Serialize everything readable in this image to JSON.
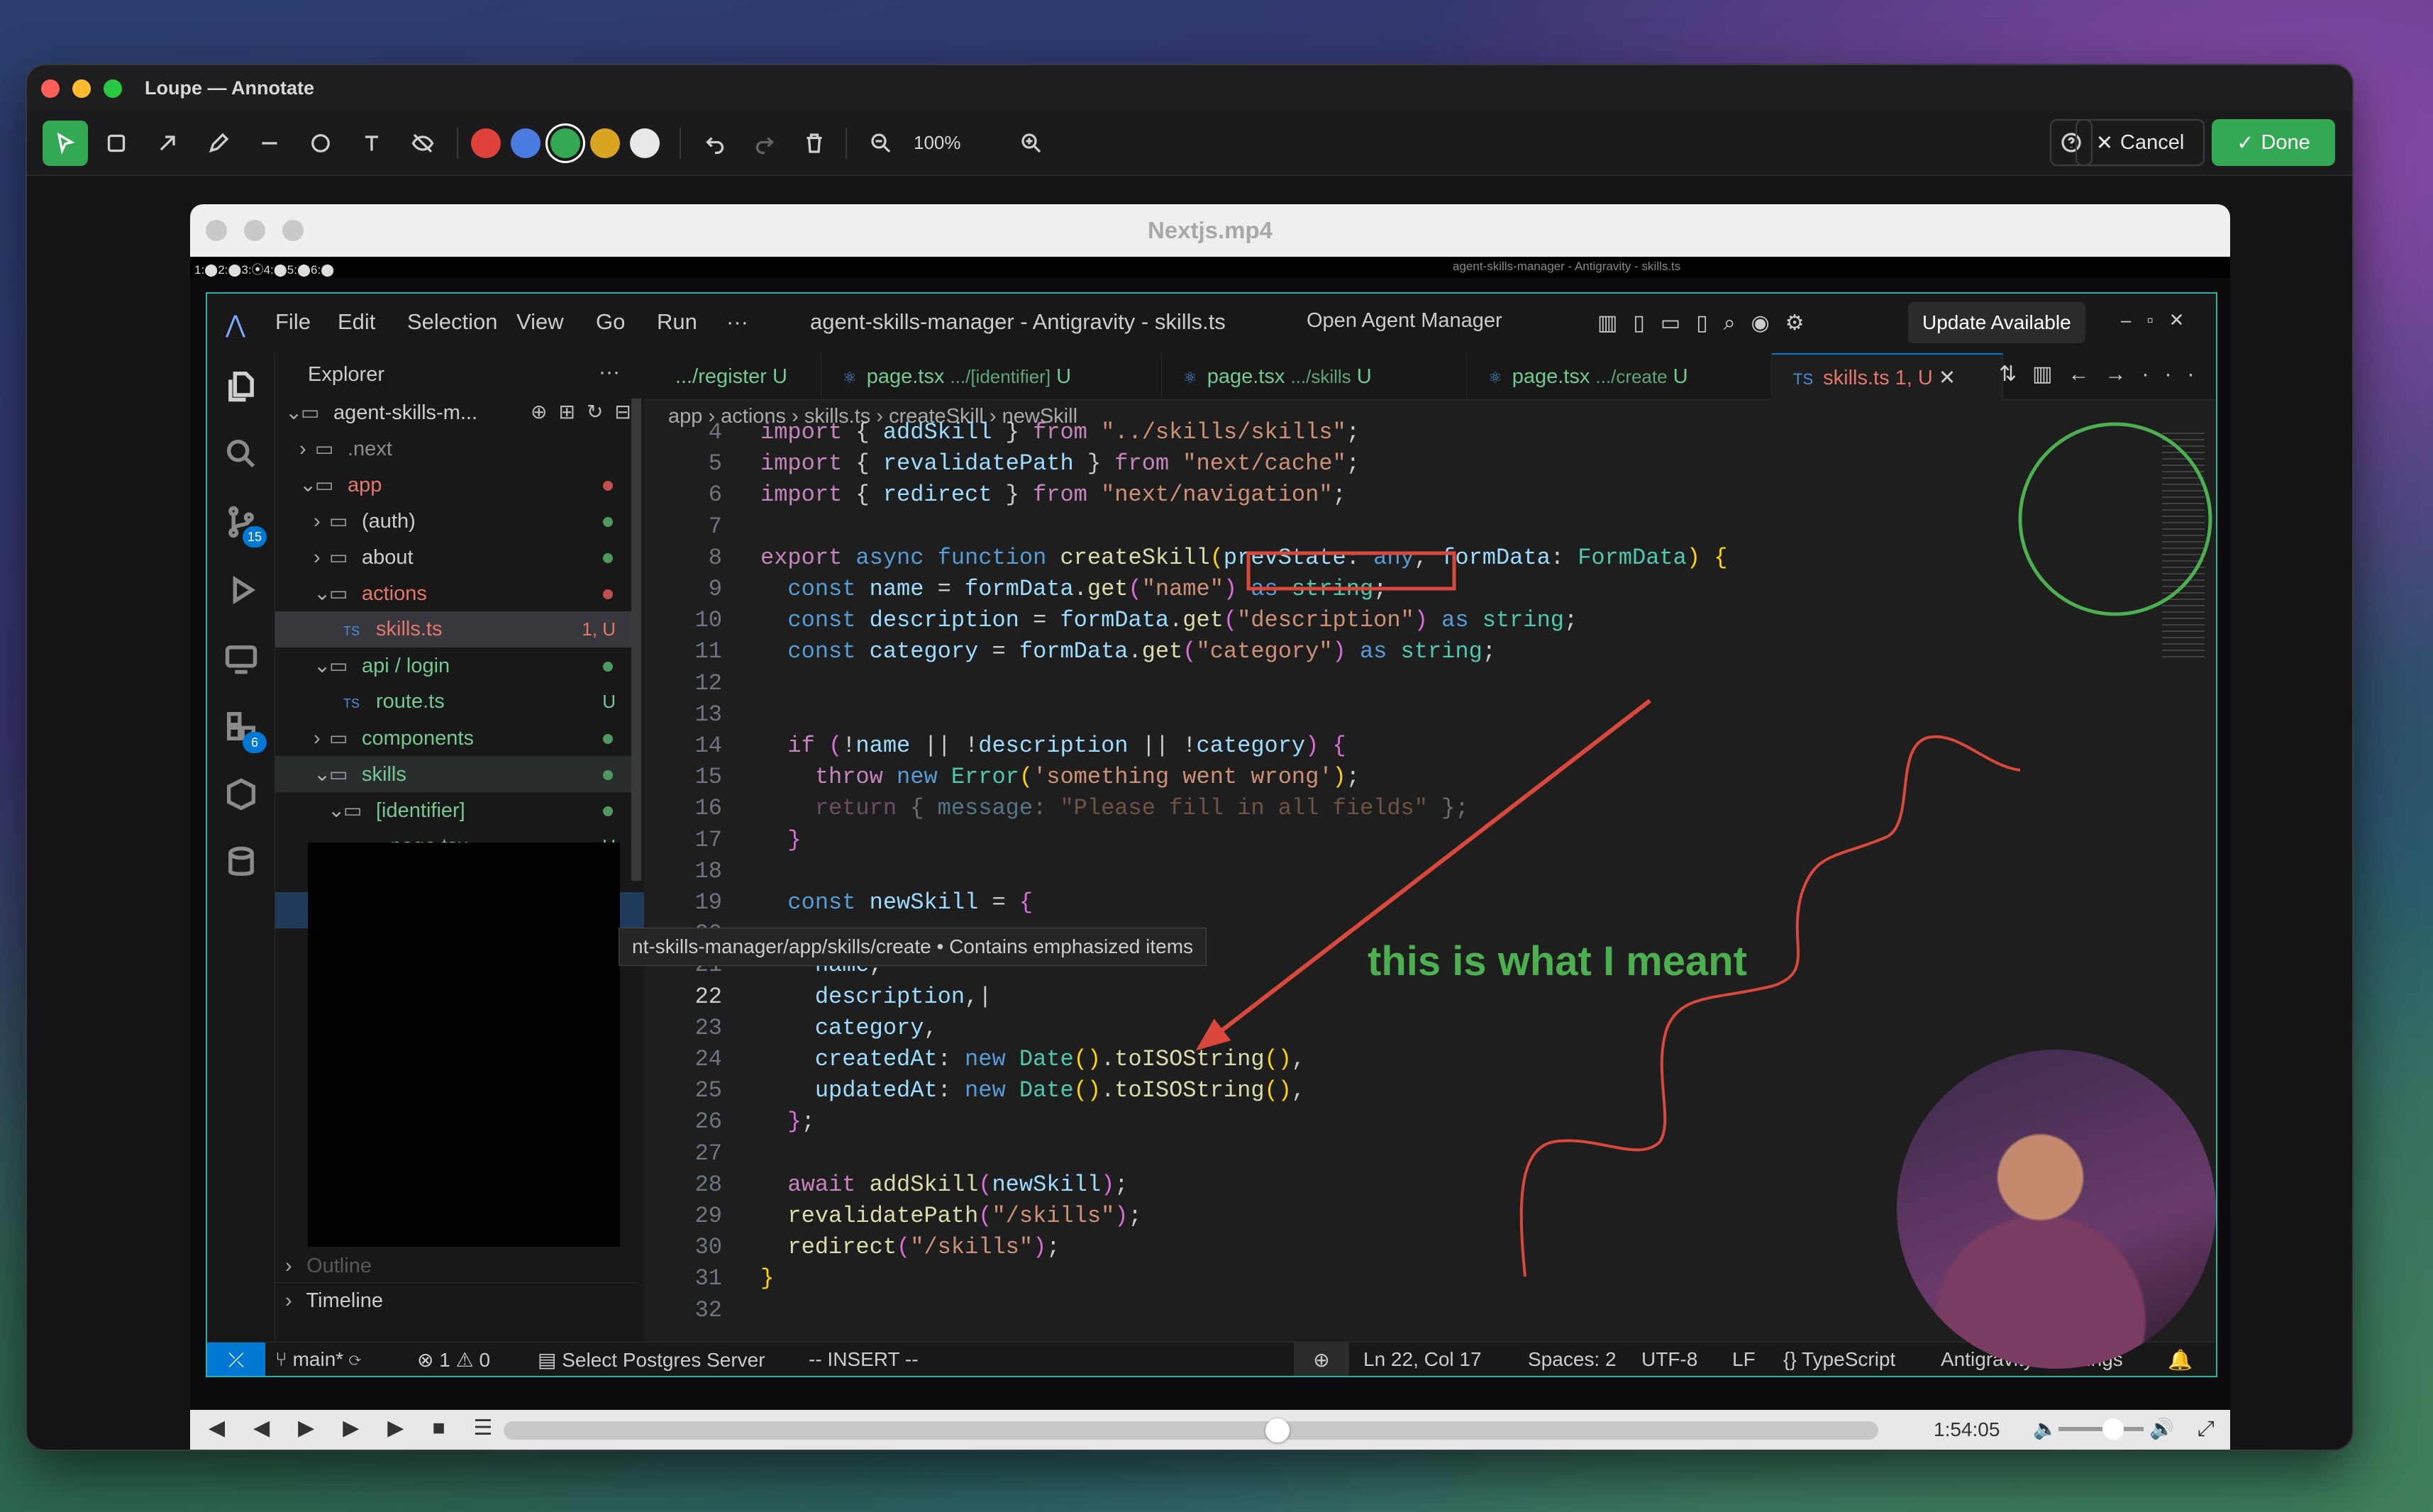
{
  "loupe": {
    "title": "Loupe — Annotate",
    "zoom": "100%",
    "cancel_label": "Cancel",
    "done_label": "Done",
    "colors": [
      "#e0413b",
      "#4a7be0",
      "#34a853",
      "#d9a520",
      "#e8e8e8"
    ]
  },
  "video": {
    "title": "Nextjs.mp4",
    "strip_left": "1:⬤2:⬤3:⦿4:⬤5:⬤6:⬤",
    "strip_center": "agent-skills-manager - Antigravity - skills.ts",
    "timecode": "1:54:05"
  },
  "ide": {
    "menu": [
      "File",
      "Edit",
      "Selection",
      "View",
      "Go",
      "Run",
      "···"
    ],
    "window_title": "agent-skills-manager - Antigravity - skills.ts",
    "open_agent": "Open Agent Manager",
    "update": "Update Available",
    "explorer_title": "Explorer",
    "tree": [
      {
        "label": "agent-skills-m...",
        "indent": 0,
        "chev": "v"
      },
      {
        "label": ".next",
        "indent": 1,
        "chev": ">",
        "color": "#8c8c8c"
      },
      {
        "label": "app",
        "indent": 1,
        "chev": "v",
        "color": "#e2786b",
        "dot": "#c0504d"
      },
      {
        "label": "(auth)",
        "indent": 2,
        "chev": ">",
        "dot": "#4e9a5e"
      },
      {
        "label": "about",
        "indent": 2,
        "chev": ">",
        "dot": "#4e9a5e"
      },
      {
        "label": "actions",
        "indent": 2,
        "chev": "v",
        "color": "#e2786b",
        "dot": "#c0504d"
      },
      {
        "label": "skills.ts",
        "indent": 3,
        "file": "TS",
        "color": "#e2786b",
        "status": "1, U",
        "selected": true
      },
      {
        "label": "api / login",
        "indent": 2,
        "chev": "v",
        "color": "#73c991",
        "dot": "#4e9a5e"
      },
      {
        "label": "route.ts",
        "indent": 3,
        "file": "TS",
        "color": "#73c991",
        "status": "U"
      },
      {
        "label": "components",
        "indent": 2,
        "chev": ">",
        "color": "#73c991",
        "dot": "#4e9a5e"
      },
      {
        "label": "skills",
        "indent": 2,
        "chev": "v",
        "color": "#73c991",
        "dot": "#4e9a5e",
        "hover": true
      },
      {
        "label": "[identifier]",
        "indent": 3,
        "chev": "v",
        "color": "#73c991",
        "dot": "#4e9a5e"
      },
      {
        "label": "page.tsx",
        "indent": 4,
        "file": "⚛",
        "color": "#73c991",
        "status": "U"
      }
    ],
    "outline_label": "Outline",
    "timeline_label": "Timeline",
    "tabs": [
      {
        "name": ".../register",
        "suffix": "U",
        "icon": ""
      },
      {
        "name": "page.tsx",
        "desc": ".../[identifier]",
        "suffix": "U",
        "icon": "⚛"
      },
      {
        "name": "page.tsx",
        "desc": ".../skills",
        "suffix": "U",
        "icon": "⚛"
      },
      {
        "name": "page.tsx",
        "desc": ".../create",
        "suffix": "U",
        "icon": "⚛"
      },
      {
        "name": "skills.ts",
        "desc": "",
        "suffix": "1, U",
        "icon": "TS",
        "active": true
      }
    ],
    "breadcrumb": [
      "app",
      "actions",
      "skills.ts",
      "createSkill",
      "newSkill"
    ],
    "tooltip": "nt-skills-manager/app/skills/create • Contains emphasized items",
    "code": [
      {
        "n": "4",
        "h": "<span class=\"k\">import</span> { <span class=\"v\">addSkill</span> } <span class=\"k\">from</span> <span class=\"s\">\"../skills/skills\"</span>;"
      },
      {
        "n": "5",
        "h": "<span class=\"k\">import</span> { <span class=\"v\">revalidatePath</span> } <span class=\"k\">from</span> <span class=\"s\">\"next/cache\"</span>;"
      },
      {
        "n": "6",
        "h": "<span class=\"k\">import</span> { <span class=\"v\">redirect</span> } <span class=\"k\">from</span> <span class=\"s\">\"next/navigation\"</span>;"
      },
      {
        "n": "7",
        "h": ""
      },
      {
        "n": "8",
        "h": "<span class=\"k\">export</span> <span class=\"b\">async</span> <span class=\"b\">function</span> <span class=\"f\">createSkill</span><span class=\"p\">(</span><span class=\"v\">prevState</span>: <span class=\"b\">any</span>, <span class=\"v\">formData</span>: <span class=\"t\">FormData</span><span class=\"p\">)</span> <span class=\"p\">{</span>"
      },
      {
        "n": "9",
        "h": "  <span class=\"b\">const</span> <span class=\"v\">name</span> = <span class=\"v\">formData</span>.<span class=\"f\">get</span><span class=\"c\">(</span><span class=\"s\">\"name\"</span><span class=\"c\">)</span> <span class=\"b\">as</span> <span class=\"t\">string</span>;"
      },
      {
        "n": "10",
        "h": "  <span class=\"b\">const</span> <span class=\"v\">description</span> = <span class=\"v\">formData</span>.<span class=\"f\">get</span><span class=\"c\">(</span><span class=\"s\">\"description\"</span><span class=\"c\">)</span> <span class=\"b\">as</span> <span class=\"t\">string</span>;"
      },
      {
        "n": "11",
        "h": "  <span class=\"b\">const</span> <span class=\"v\">category</span> = <span class=\"v\">formData</span>.<span class=\"f\">get</span><span class=\"c\">(</span><span class=\"s\">\"category\"</span><span class=\"c\">)</span> <span class=\"b\">as</span> <span class=\"t\">string</span>;"
      },
      {
        "n": "12",
        "h": ""
      },
      {
        "n": "13",
        "h": ""
      },
      {
        "n": "14",
        "h": "  <span class=\"k\">if</span> <span class=\"c\">(</span>!<span class=\"v\">name</span> || !<span class=\"v\">description</span> || !<span class=\"v\">category</span><span class=\"c\">)</span> <span class=\"c\">{</span>"
      },
      {
        "n": "15",
        "h": "    <span class=\"k\">throw</span> <span class=\"b\">new</span> <span class=\"t\">Error</span><span class=\"p\">(</span><span class=\"s\">'something went wrong'</span><span class=\"p\">)</span>;"
      },
      {
        "n": "16",
        "h": "    <span style=\"opacity:.45\"><span class=\"k\">return</span> { <span class=\"v\">message</span>: <span class=\"s\">\"Please fill in all fields\"</span> };</span>"
      },
      {
        "n": "17",
        "h": "  <span class=\"c\">}</span>"
      },
      {
        "n": "18",
        "h": ""
      },
      {
        "n": "19",
        "h": "  <span class=\"b\">const</span> <span class=\"v\">newSkill</span> = <span class=\"c\">{</span>"
      },
      {
        "n": "20",
        "h": ""
      },
      {
        "n": "21",
        "h": "    <span class=\"v\">name</span>,"
      },
      {
        "n": "22",
        "h": "    <span class=\"v\">description</span>,|"
      },
      {
        "n": "23",
        "h": "    <span class=\"v\">category</span>,"
      },
      {
        "n": "24",
        "h": "    <span class=\"v\">createdAt</span>: <span class=\"b\">new</span> <span class=\"t\">Date</span><span class=\"p\">()</span>.<span class=\"f\">toISOString</span><span class=\"p\">()</span>,"
      },
      {
        "n": "25",
        "h": "    <span class=\"v\">updatedAt</span>: <span class=\"b\">new</span> <span class=\"t\">Date</span><span class=\"p\">()</span>.<span class=\"f\">toISOString</span><span class=\"p\">()</span>,"
      },
      {
        "n": "26",
        "h": "  <span class=\"c\">}</span>;"
      },
      {
        "n": "27",
        "h": ""
      },
      {
        "n": "28",
        "h": "  <span class=\"k\">await</span> <span class=\"f\">addSkill</span><span class=\"c\">(</span><span class=\"v\">newSkill</span><span class=\"c\">)</span>;"
      },
      {
        "n": "29",
        "h": "  <span class=\"f\">revalidatePath</span><span class=\"c\">(</span><span class=\"s\">\"/skills\"</span><span class=\"c\">)</span>;"
      },
      {
        "n": "30",
        "h": "  <span class=\"f\">redirect</span><span class=\"c\">(</span><span class=\"s\">\"/skills\"</span><span class=\"c\">)</span>;"
      },
      {
        "n": "31",
        "h": "<span class=\"p\">}</span>"
      },
      {
        "n": "32",
        "h": ""
      }
    ],
    "status": {
      "branch": "main*",
      "problems": "⊗ 1 ⚠ 0",
      "db": "Select Postgres Server",
      "mode": "-- INSERT --",
      "cursor": "Ln 22, Col 17",
      "spaces": "Spaces: 2",
      "encoding": "UTF-8",
      "eol": "LF",
      "lang": "TypeScript",
      "settings": "Antigravity - Settings"
    }
  },
  "annotation": {
    "text": "this is what I meant",
    "arrow_color": "#d9483b",
    "text_color": "#4cb050"
  }
}
